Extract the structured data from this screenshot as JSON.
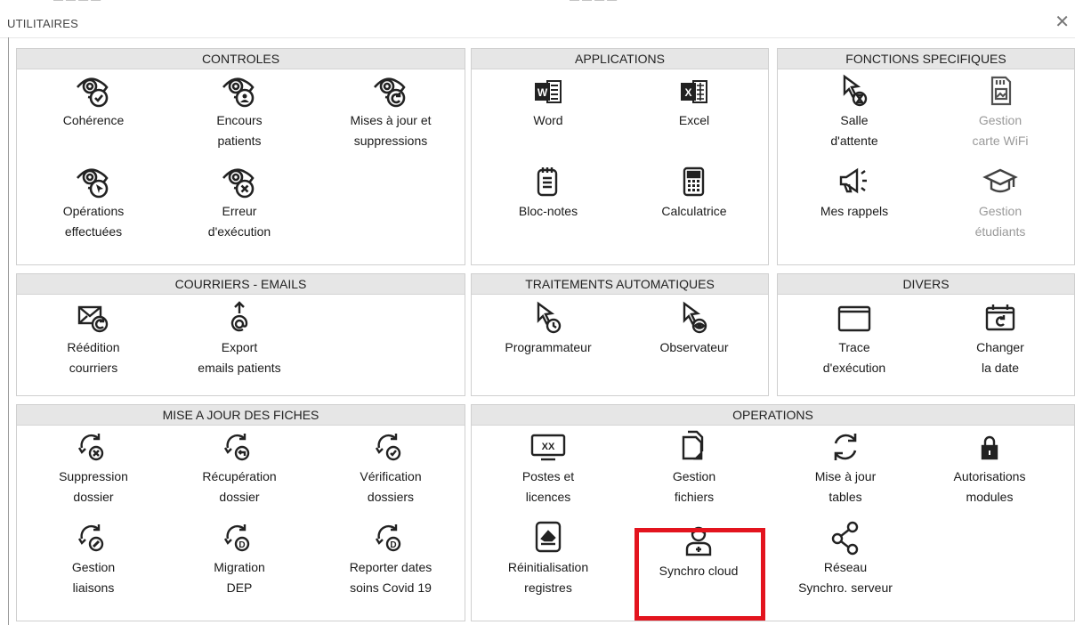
{
  "window": {
    "title": "UTILITAIRES",
    "close_icon": "close-icon"
  },
  "colors": {
    "header_bg": "#e6e6e6",
    "highlight": "#e3141e",
    "disabled_text": "#9a9a9a"
  },
  "sections": {
    "controles": {
      "title": "CONTROLES",
      "items": [
        {
          "line1": "Cohérence",
          "line2": "",
          "icon": "eye-check-icon"
        },
        {
          "line1": "Encours",
          "line2": "patients",
          "icon": "eye-user-icon"
        },
        {
          "line1": "Mises à jour et",
          "line2": "suppressions",
          "icon": "eye-refresh-icon"
        },
        {
          "line1": "Opérations",
          "line2": "effectuées",
          "icon": "eye-cursor-icon"
        },
        {
          "line1": "Erreur",
          "line2": "d'exécution",
          "icon": "eye-error-icon"
        }
      ]
    },
    "applications": {
      "title": "APPLICATIONS",
      "items": [
        {
          "line1": "Word",
          "line2": "",
          "icon": "word-icon"
        },
        {
          "line1": "Excel",
          "line2": "",
          "icon": "excel-icon"
        },
        {
          "line1": "Bloc-notes",
          "line2": "",
          "icon": "notepad-icon"
        },
        {
          "line1": "Calculatrice",
          "line2": "",
          "icon": "calculator-icon"
        }
      ]
    },
    "fonctions": {
      "title": "FONCTIONS SPECIFIQUES",
      "items": [
        {
          "line1": "Salle",
          "line2": "d'attente",
          "icon": "cursor-hourglass-icon"
        },
        {
          "line1": "Gestion",
          "line2": "carte WiFi",
          "icon": "sd-card-icon",
          "disabled": true
        },
        {
          "line1": "Mes rappels",
          "line2": "",
          "icon": "megaphone-icon"
        },
        {
          "line1": "Gestion",
          "line2": "étudiants",
          "icon": "graduation-cap-icon",
          "disabled": true
        }
      ]
    },
    "courriers": {
      "title": "COURRIERS - EMAILS",
      "items": [
        {
          "line1": "Réédition",
          "line2": "courriers",
          "icon": "mail-refresh-icon"
        },
        {
          "line1": "Export",
          "line2": "emails patients",
          "icon": "at-upload-icon"
        }
      ]
    },
    "traitements": {
      "title": "TRAITEMENTS AUTOMATIQUES",
      "items": [
        {
          "line1": "Programmateur",
          "line2": "",
          "icon": "cursor-clock-icon"
        },
        {
          "line1": "Observateur",
          "line2": "",
          "icon": "cursor-eye-icon"
        }
      ]
    },
    "divers": {
      "title": "DIVERS",
      "items": [
        {
          "line1": "Trace",
          "line2": "d'exécution",
          "icon": "window-icon"
        },
        {
          "line1": "Changer",
          "line2": "la date",
          "icon": "calendar-refresh-icon"
        }
      ]
    },
    "mise_a_jour": {
      "title": "MISE A JOUR DES FICHES",
      "items": [
        {
          "line1": "Suppression",
          "line2": "dossier",
          "icon": "sync-delete-icon"
        },
        {
          "line1": "Récupération",
          "line2": "dossier",
          "icon": "sync-restore-icon"
        },
        {
          "line1": "Vérification",
          "line2": "dossiers",
          "icon": "sync-check-icon"
        },
        {
          "line1": "Gestion",
          "line2": "liaisons",
          "icon": "sync-link-icon"
        },
        {
          "line1": "Migration",
          "line2": "DEP",
          "icon": "sync-d-icon"
        },
        {
          "line1": "Reporter dates",
          "line2": "soins Covid 19",
          "icon": "sync-d2-icon"
        }
      ]
    },
    "operations": {
      "title": "OPERATIONS",
      "items": [
        {
          "line1": "Postes et",
          "line2": "licences",
          "icon": "monitor-xx-icon"
        },
        {
          "line1": "Gestion",
          "line2": "fichiers",
          "icon": "files-icon"
        },
        {
          "line1": "Mise à jour",
          "line2": "tables",
          "icon": "refresh-icon"
        },
        {
          "line1": "Autorisations",
          "line2": "modules",
          "icon": "lock-icon"
        },
        {
          "line1": "Réinitialisation",
          "line2": "registres",
          "icon": "eraser-icon"
        },
        {
          "line1": "Synchro cloud",
          "line2": "",
          "icon": "doctor-icon",
          "highlighted": true
        },
        {
          "line1": "Réseau",
          "line2": "Synchro. serveur",
          "icon": "share-icon"
        }
      ]
    }
  }
}
